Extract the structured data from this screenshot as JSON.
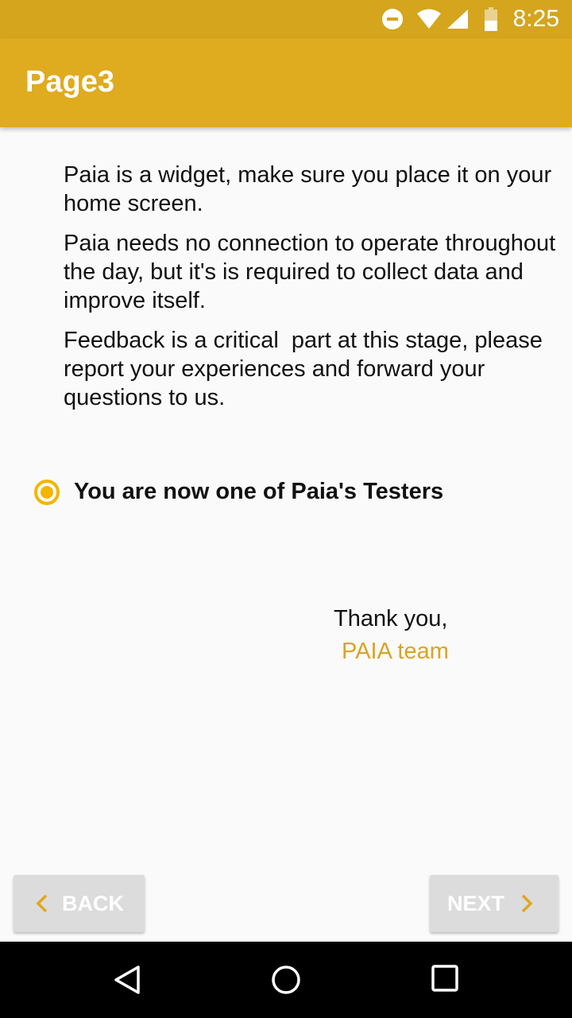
{
  "status_bar": {
    "time": "8:25",
    "icons": [
      "do-not-disturb-icon",
      "wifi-icon",
      "signal-icon",
      "battery-icon"
    ]
  },
  "app_bar": {
    "title": "Page3",
    "color": "#dfab1f"
  },
  "content": {
    "paragraphs": [
      "Paia is a widget, make sure you place it on your home screen.",
      "Paia needs no connection to operate throughout the day, but it's is required to collect data and improve itself.",
      "Feedback is a critical  part at this stage, please report your experiences and forward your questions to us."
    ],
    "radio_label": "You are now one of Paia's Testers",
    "radio_checked": true,
    "thanks": "Thank you,",
    "team": "PAIA team"
  },
  "nav": {
    "back_label": "BACK",
    "next_label": "NEXT"
  },
  "colors": {
    "accent": "#f4b500",
    "status_bar": "#d4a51d",
    "team_text": "#d9a520"
  },
  "system_nav": {
    "icons": [
      "back-icon",
      "home-icon",
      "recents-icon"
    ]
  }
}
